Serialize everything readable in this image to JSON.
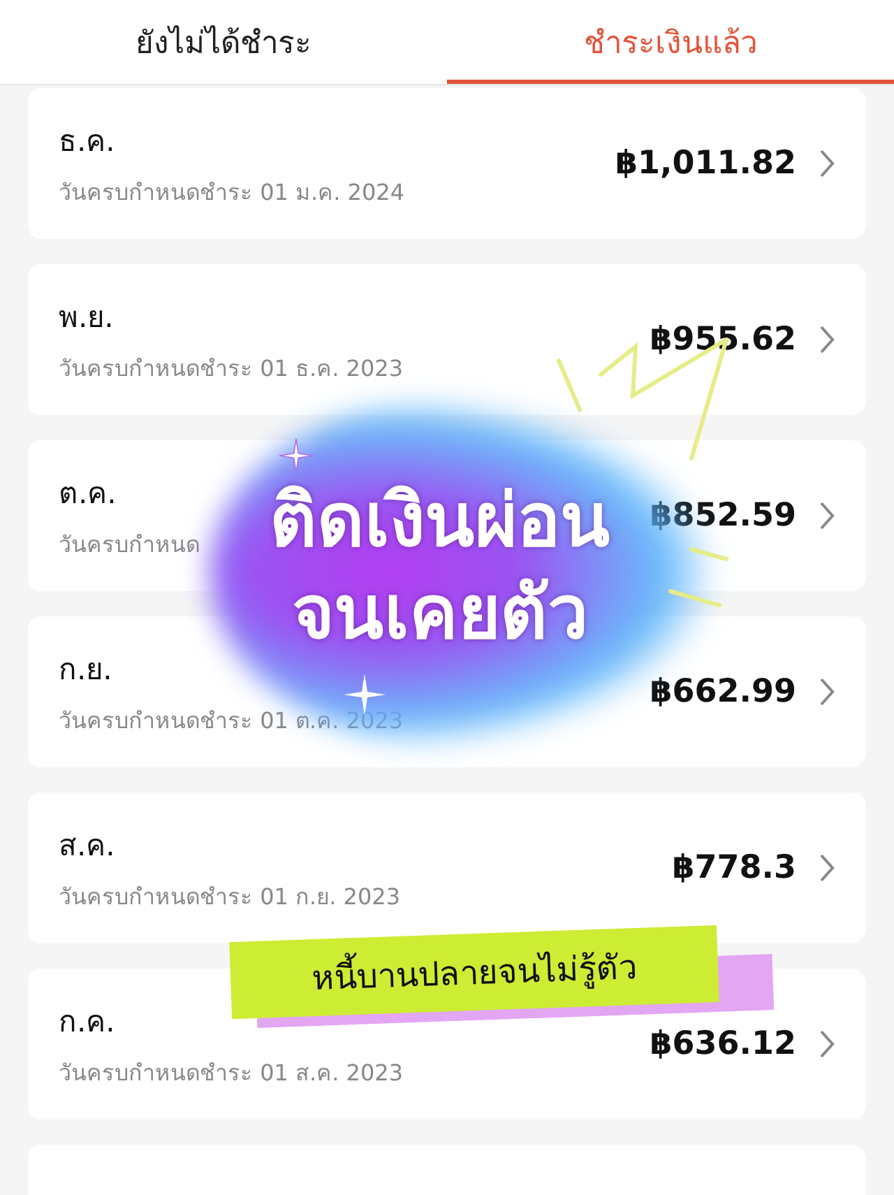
{
  "tabs": [
    {
      "label": "ยังไม่ได้ชำระ",
      "selected": false
    },
    {
      "label": "ชำระเงินแล้ว",
      "selected": true
    }
  ],
  "bills": [
    {
      "month": "ธ.ค.",
      "due": "วันครบกำหนดชำระ 01 ม.ค. 2024",
      "amount": "฿1,011.82"
    },
    {
      "month": "พ.ย.",
      "due": "วันครบกำหนดชำระ 01 ธ.ค. 2023",
      "amount": "฿955.62"
    },
    {
      "month": "ต.ค.",
      "due": "วันครบกำหนด",
      "amount": "฿852.59"
    },
    {
      "month": "ก.ย.",
      "due": "วันครบกำหนดชำระ 01 ต.ค. 2023",
      "amount": "฿662.99"
    },
    {
      "month": "ส.ค.",
      "due": "วันครบกำหนดชำระ 01 ก.ย. 2023",
      "amount": "฿778.3"
    },
    {
      "month": "ก.ค.",
      "due": "วันครบกำหนดชำระ 01 ส.ค. 2023",
      "amount": "฿636.12"
    }
  ],
  "overlay": {
    "headline": [
      "ติดเงินผ่อน",
      "จนเคยตัว"
    ],
    "sticker": "หนี้บานปลายจนไม่รู้ตัว"
  }
}
